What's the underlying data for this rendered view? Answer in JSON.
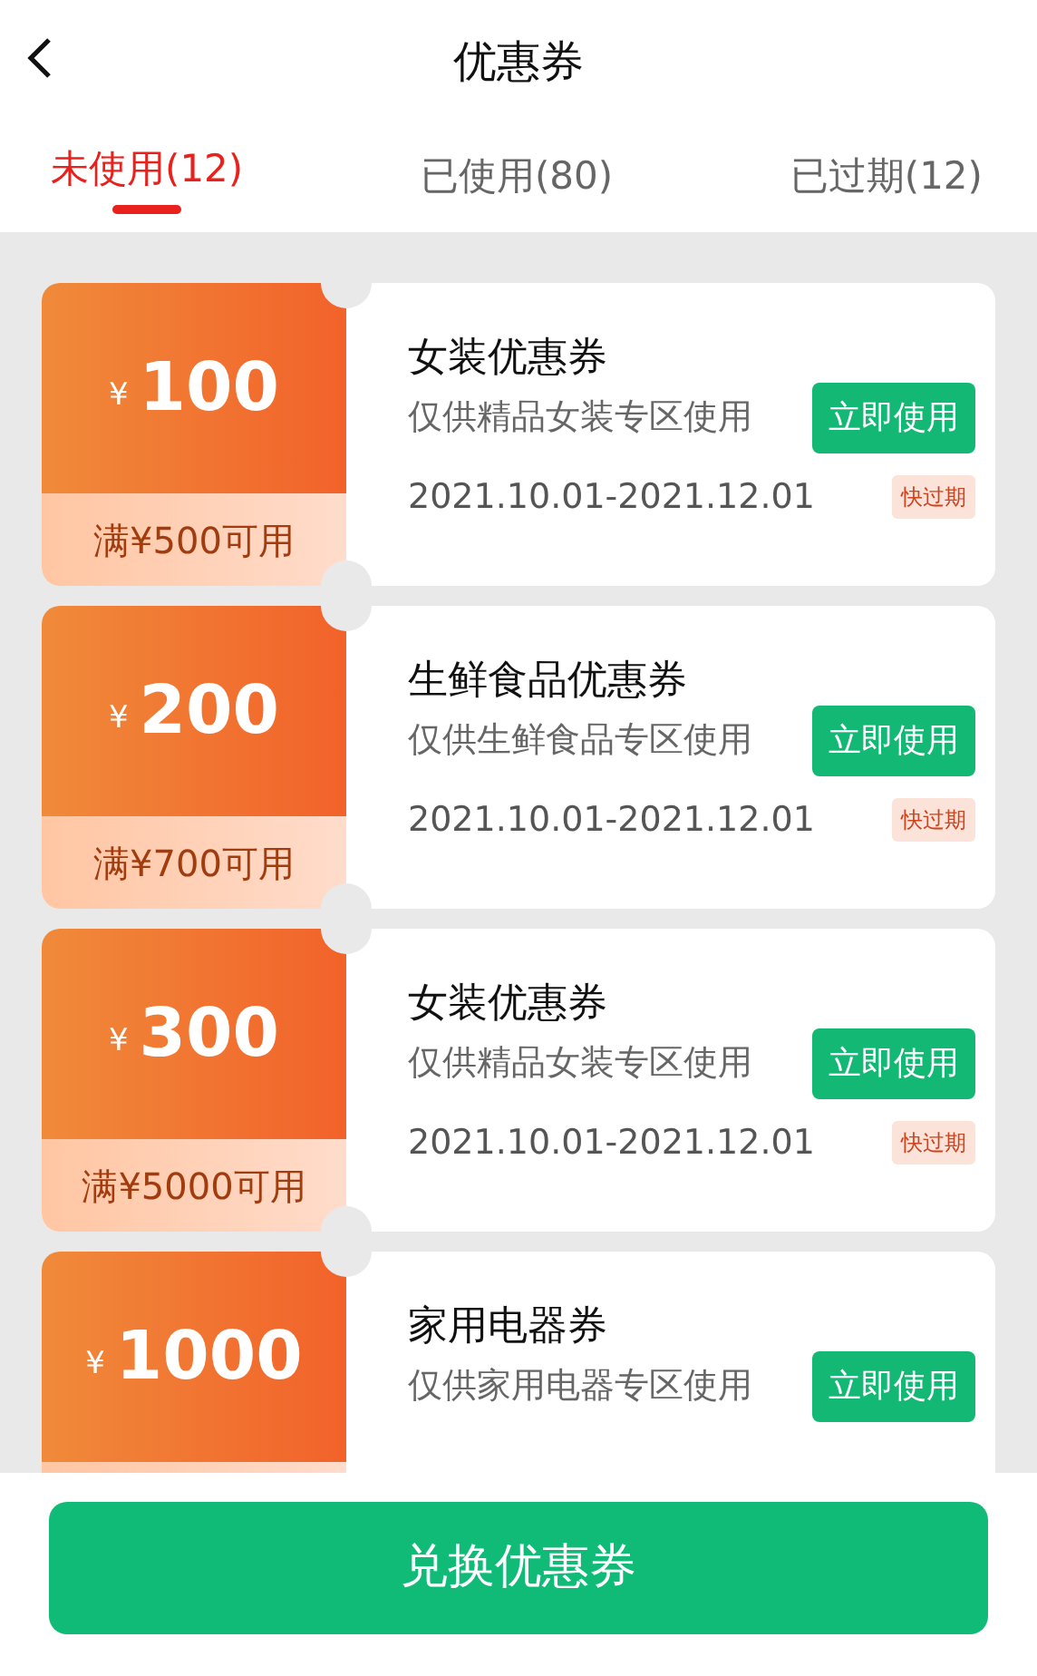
{
  "header": {
    "title": "优惠券"
  },
  "tabs": [
    {
      "label": "未使用(12)",
      "selected": true
    },
    {
      "label": "已使用(80)",
      "selected": false
    },
    {
      "label": "已过期(12)",
      "selected": false
    }
  ],
  "coupons": [
    {
      "currency": "¥",
      "amount": "100",
      "condition": "满¥500可用",
      "title": "女装优惠券",
      "description": "仅供精品女装专区使用",
      "button": "立即使用",
      "validity": "2021.10.01-2021.12.01",
      "tag": "快过期"
    },
    {
      "currency": "¥",
      "amount": "200",
      "condition": "满¥700可用",
      "title": "生鲜食品优惠券",
      "description": "仅供生鲜食品专区使用",
      "button": "立即使用",
      "validity": "2021.10.01-2021.12.01",
      "tag": "快过期"
    },
    {
      "currency": "¥",
      "amount": "300",
      "condition": "满¥5000可用",
      "title": "女装优惠券",
      "description": "仅供精品女装专区使用",
      "button": "立即使用",
      "validity": "2021.10.01-2021.12.01",
      "tag": "快过期"
    },
    {
      "currency": "¥",
      "amount": "1000",
      "title": "家用电器券",
      "description": "仅供家用电器专区使用",
      "button": "立即使用"
    }
  ],
  "footer": {
    "button": "兑换优惠券"
  }
}
